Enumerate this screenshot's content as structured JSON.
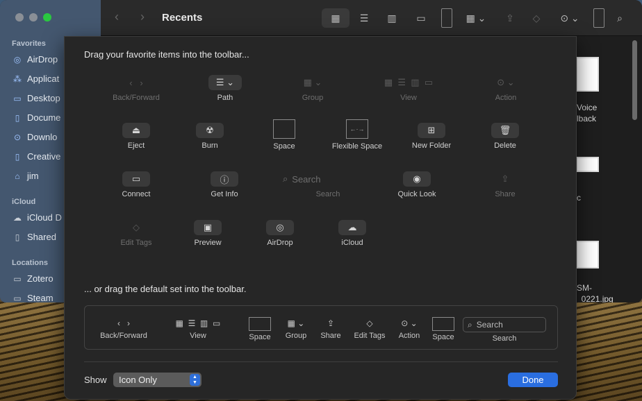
{
  "finder": {
    "title": "Recents",
    "sidebar": {
      "favorites_label": "Favorites",
      "favorites": [
        {
          "label": "AirDrop",
          "icon": "airdrop-icon"
        },
        {
          "label": "Applicat",
          "icon": "applications-icon"
        },
        {
          "label": "Desktop",
          "icon": "desktop-icon"
        },
        {
          "label": "Docume",
          "icon": "document-icon"
        },
        {
          "label": "Downlo",
          "icon": "downloads-icon"
        },
        {
          "label": "Creative",
          "icon": "folder-icon"
        },
        {
          "label": "jim",
          "icon": "home-icon"
        }
      ],
      "icloud_label": "iCloud",
      "icloud": [
        {
          "label": "iCloud D",
          "icon": "cloud-icon"
        },
        {
          "label": "Shared",
          "icon": "shared-folder-icon"
        }
      ],
      "locations_label": "Locations",
      "locations": [
        {
          "label": "Zotero",
          "icon": "drive-icon"
        },
        {
          "label": "Steam",
          "icon": "drive-icon"
        }
      ]
    },
    "content": {
      "item1_line1": "Voice",
      "item1_line2": "lback",
      "item2_text": "c",
      "item3_line1": "SM-",
      "item3_line2": "_0221.jpg"
    }
  },
  "sheet": {
    "heading_top": "Drag your favorite items into the toolbar...",
    "heading_default": "... or drag the default set into the toolbar.",
    "items": {
      "back_forward": "Back/Forward",
      "path": "Path",
      "group": "Group",
      "view": "View",
      "action": "Action",
      "eject": "Eject",
      "burn": "Burn",
      "space": "Space",
      "flexible_space": "Flexible Space",
      "new_folder": "New Folder",
      "delete": "Delete",
      "connect": "Connect",
      "get_info": "Get Info",
      "search_placeholder": "Search",
      "search": "Search",
      "quick_look": "Quick Look",
      "share": "Share",
      "edit_tags": "Edit Tags",
      "preview": "Preview",
      "airdrop": "AirDrop",
      "icloud": "iCloud"
    },
    "default_set": {
      "back_forward": "Back/Forward",
      "view": "View",
      "space": "Space",
      "group": "Group",
      "share": "Share",
      "edit_tags": "Edit Tags",
      "action": "Action",
      "space2": "Space",
      "search_placeholder": "Search",
      "search": "Search"
    },
    "show_label": "Show",
    "show_value": "Icon Only",
    "done_label": "Done"
  }
}
